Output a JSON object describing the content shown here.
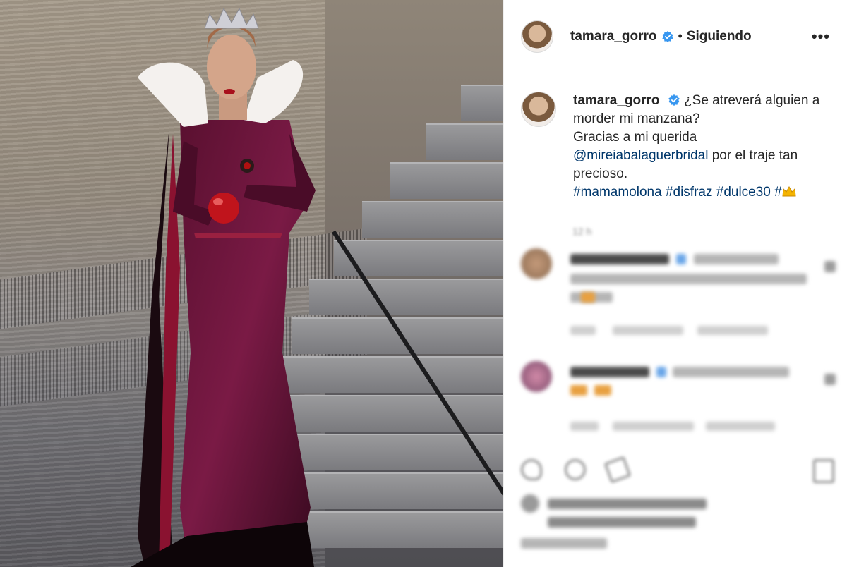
{
  "post": {
    "header": {
      "username": "tamara_gorro",
      "separator": "•",
      "follow_status": "Siguiendo",
      "more_label": "•••"
    },
    "caption": {
      "username": "tamara_gorro",
      "line1": "¿Se atreverá alguien a morder mi manzana?",
      "line2": "Gracias a mi querida",
      "mention": "@mireiabalaguerbridal",
      "line3": "por el traje tan precioso.",
      "hashtags": "#mamamolona #disfraz #dulce30 #"
    },
    "timestamp": "12 h"
  },
  "colors": {
    "verified": "#3897f0",
    "link": "#00376b",
    "text": "#262626",
    "muted": "#8e8e8e"
  },
  "icons": [
    "verified-badge-icon",
    "more-options-icon",
    "crown-emoji-icon",
    "heart-icon",
    "comment-icon",
    "share-icon",
    "bookmark-icon"
  ]
}
